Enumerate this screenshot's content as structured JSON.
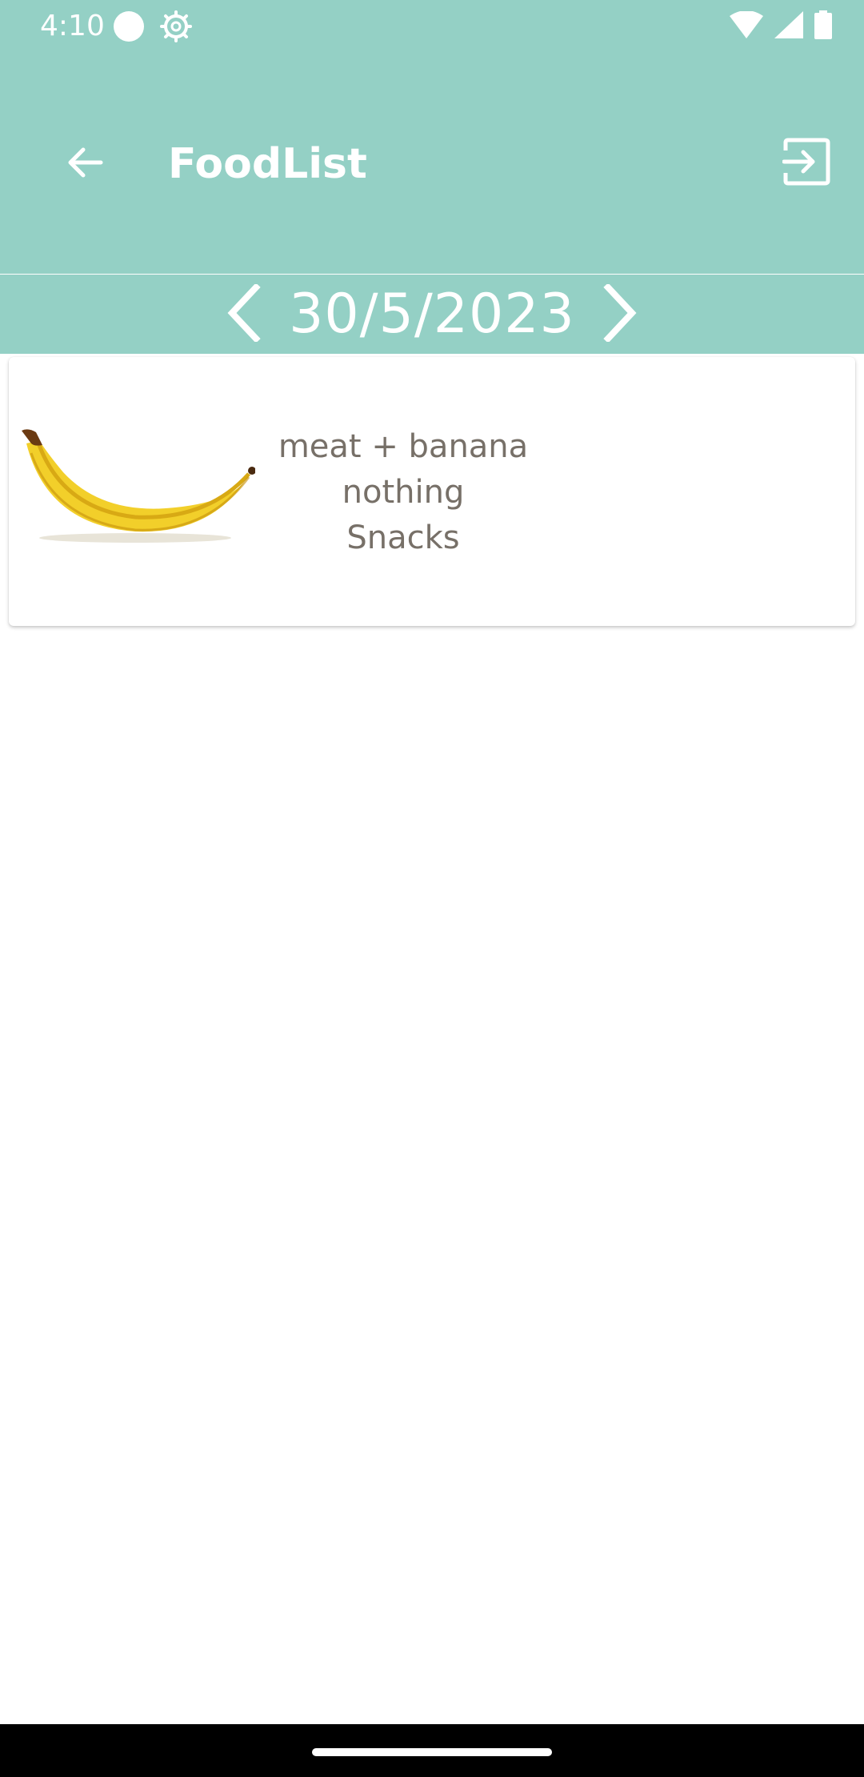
{
  "status_bar": {
    "time": "4:10",
    "icons": [
      "notification-dot-icon",
      "settings-gear-icon",
      "wifi-icon",
      "cell-signal-icon",
      "battery-icon"
    ]
  },
  "app_bar": {
    "title": "FoodList",
    "back_icon": "arrow-back-icon",
    "logout_icon": "logout-icon",
    "background_color": "#94d0c5"
  },
  "date_nav": {
    "date": "30/5/2023",
    "prev_icon": "chevron-left-icon",
    "next_icon": "chevron-right-icon"
  },
  "food_list": {
    "items": [
      {
        "image": "banana-image",
        "name": "meat + banana",
        "note": "nothing",
        "category": "Snacks"
      }
    ]
  },
  "colors": {
    "accent": "#94d0c5",
    "item_text": "#777068"
  }
}
